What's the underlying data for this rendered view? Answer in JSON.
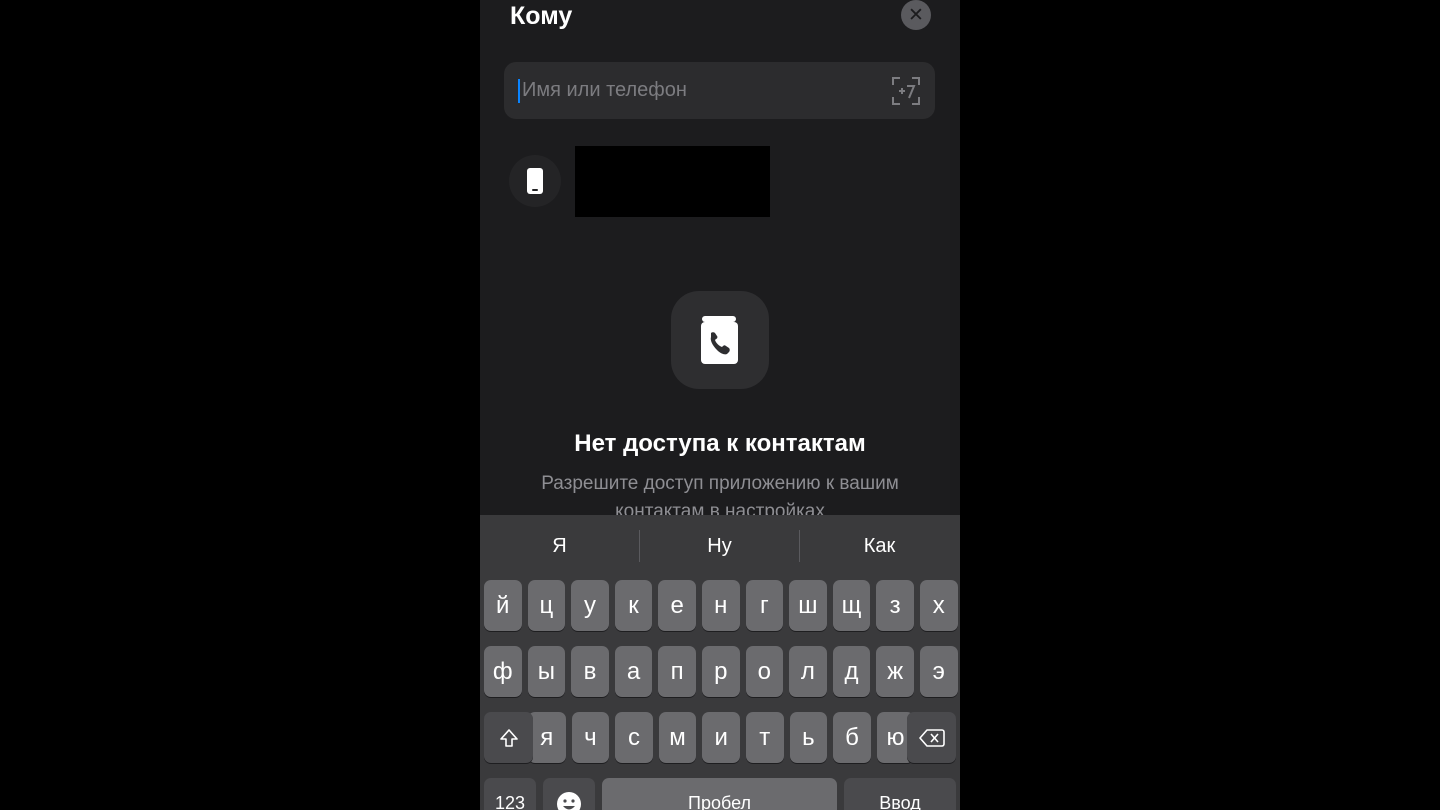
{
  "header": {
    "title": "Кому",
    "close_icon": "close-icon"
  },
  "search": {
    "placeholder": "Имя или телефон",
    "value": "",
    "scan_icon": "plus-seven-scan-icon"
  },
  "recent": {
    "icon": "mobile-phone-icon"
  },
  "empty_state": {
    "icon": "contacts-book-phone-icon",
    "title": "Нет доступа к контактам",
    "text": "Разрешите доступ приложению к вашим контактам в настройках"
  },
  "keyboard": {
    "suggestions": [
      "Я",
      "Ну",
      "Как"
    ],
    "row1": [
      "й",
      "ц",
      "у",
      "к",
      "е",
      "н",
      "г",
      "ш",
      "щ",
      "з",
      "х"
    ],
    "row2": [
      "ф",
      "ы",
      "в",
      "а",
      "п",
      "р",
      "о",
      "л",
      "д",
      "ж",
      "э"
    ],
    "row3": [
      "я",
      "ч",
      "с",
      "м",
      "и",
      "т",
      "ь",
      "б",
      "ю"
    ],
    "shift_icon": "shift-icon",
    "backspace_icon": "backspace-icon",
    "numbers_label": "123",
    "emoji_icon": "emoji-icon",
    "space_label": "Пробел",
    "return_label": "Ввод"
  }
}
